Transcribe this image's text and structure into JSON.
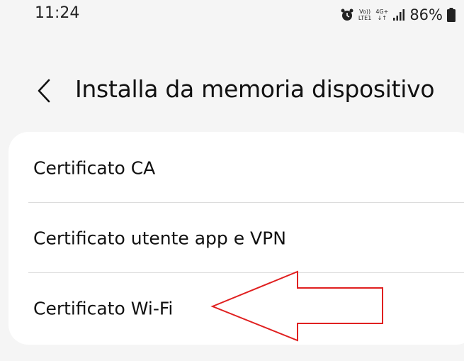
{
  "status_bar": {
    "time": "11:24",
    "net_top": "Vo))",
    "net_bottom": "LTE1",
    "data_top": "4G+",
    "data_bottom": "↓↑",
    "battery_percent": "86%"
  },
  "header": {
    "title": "Installa da memoria dispositivo"
  },
  "list": {
    "items": [
      {
        "label": "Certificato CA"
      },
      {
        "label": "Certificato utente app e VPN"
      },
      {
        "label": "Certificato Wi-Fi"
      }
    ]
  },
  "annotation": {
    "arrow_color": "#e02020"
  }
}
